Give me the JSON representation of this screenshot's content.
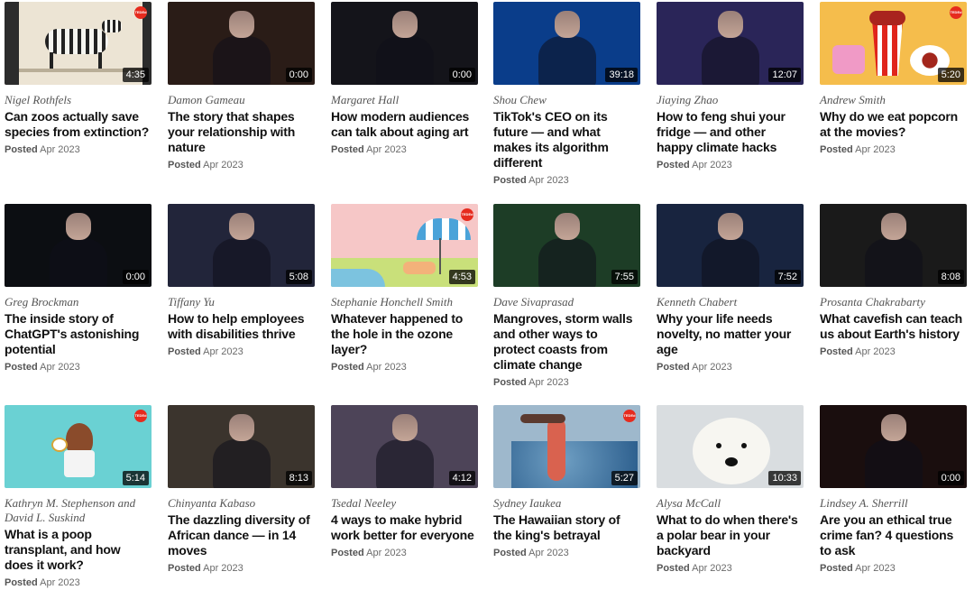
{
  "posted_label": "Posted",
  "videos": [
    {
      "speaker": "Nigel Rothfels",
      "title": "Can zoos actually save species from extinction?",
      "date": "Apr 2023",
      "duration": "4:35",
      "thumb": "zebra",
      "bg": "#ece4d4",
      "badge": true
    },
    {
      "speaker": "Damon Gameau",
      "title": "The story that shapes your relationship with nature",
      "date": "Apr 2023",
      "duration": "0:00",
      "thumb": "person",
      "bg": "#2a1c17"
    },
    {
      "speaker": "Margaret Hall",
      "title": "How modern audiences can talk about aging art",
      "date": "Apr 2023",
      "duration": "0:00",
      "thumb": "person",
      "bg": "#14141a"
    },
    {
      "speaker": "Shou Chew",
      "title": "TikTok's CEO on its future — and what makes its algorithm different",
      "date": "Apr 2023",
      "duration": "39:18",
      "thumb": "person",
      "bg": "#0a3d8a"
    },
    {
      "speaker": "Jiaying Zhao",
      "title": "How to feng shui your fridge — and other happy climate hacks",
      "date": "Apr 2023",
      "duration": "12:07",
      "thumb": "person",
      "bg": "#2a2558"
    },
    {
      "speaker": "Andrew Smith",
      "title": "Why do we eat popcorn at the movies?",
      "date": "Apr 2023",
      "duration": "5:20",
      "thumb": "popcorn",
      "bg": "#f5bd4c",
      "badge": true
    },
    {
      "speaker": "Greg Brockman",
      "title": "The inside story of ChatGPT's astonishing potential",
      "date": "Apr 2023",
      "duration": "0:00",
      "thumb": "person",
      "bg": "#0c0e12"
    },
    {
      "speaker": "Tiffany Yu",
      "title": "How to help employees with disabilities thrive",
      "date": "Apr 2023",
      "duration": "5:08",
      "thumb": "person",
      "bg": "#22253a"
    },
    {
      "speaker": "Stephanie Honchell Smith",
      "title": "Whatever happened to the hole in the ozone layer?",
      "date": "Apr 2023",
      "duration": "4:53",
      "thumb": "beach",
      "bg": "#f6c7c7",
      "badge": true
    },
    {
      "speaker": "Dave Sivaprasad",
      "title": "Mangroves, storm walls and other ways to protect coasts from climate change",
      "date": "Apr 2023",
      "duration": "7:55",
      "thumb": "person",
      "bg": "#1d3d26"
    },
    {
      "speaker": "Kenneth Chabert",
      "title": "Why your life needs novelty, no matter your age",
      "date": "Apr 2023",
      "duration": "7:52",
      "thumb": "person",
      "bg": "#18243f"
    },
    {
      "speaker": "Prosanta Chakrabarty",
      "title": "What cavefish can teach us about Earth's history",
      "date": "Apr 2023",
      "duration": "8:08",
      "thumb": "person",
      "bg": "#1a1a1a"
    },
    {
      "speaker": "Kathryn M. Stephenson and David L. Suskind",
      "title": "What is a poop transplant, and how does it work?",
      "date": "Apr 2023",
      "duration": "5:14",
      "thumb": "poop",
      "bg": "#6ad1d3",
      "badge": true
    },
    {
      "speaker": "Chinyanta Kabaso",
      "title": "The dazzling diversity of African dance — in 14 moves",
      "date": "Apr 2023",
      "duration": "8:13",
      "thumb": "person",
      "bg": "#3b342d"
    },
    {
      "speaker": "Tsedal Neeley",
      "title": "4 ways to make hybrid work better for everyone",
      "date": "Apr 2023",
      "duration": "4:12",
      "thumb": "person",
      "bg": "#4d4458"
    },
    {
      "speaker": "Sydney Iaukea",
      "title": "The Hawaiian story of the king's betrayal",
      "date": "Apr 2023",
      "duration": "5:27",
      "thumb": "wave",
      "bg": "#9eb8cc",
      "badge": true
    },
    {
      "speaker": "Alysa McCall",
      "title": "What to do when there's a polar bear in your backyard",
      "date": "Apr 2023",
      "duration": "10:33",
      "thumb": "bear",
      "bg": "#d9dde0"
    },
    {
      "speaker": "Lindsey A. Sherrill",
      "title": "Are you an ethical true crime fan? 4 questions to ask",
      "date": "Apr 2023",
      "duration": "0:00",
      "thumb": "person",
      "bg": "#1a0e0e"
    }
  ],
  "badge_text": "TEDEd"
}
